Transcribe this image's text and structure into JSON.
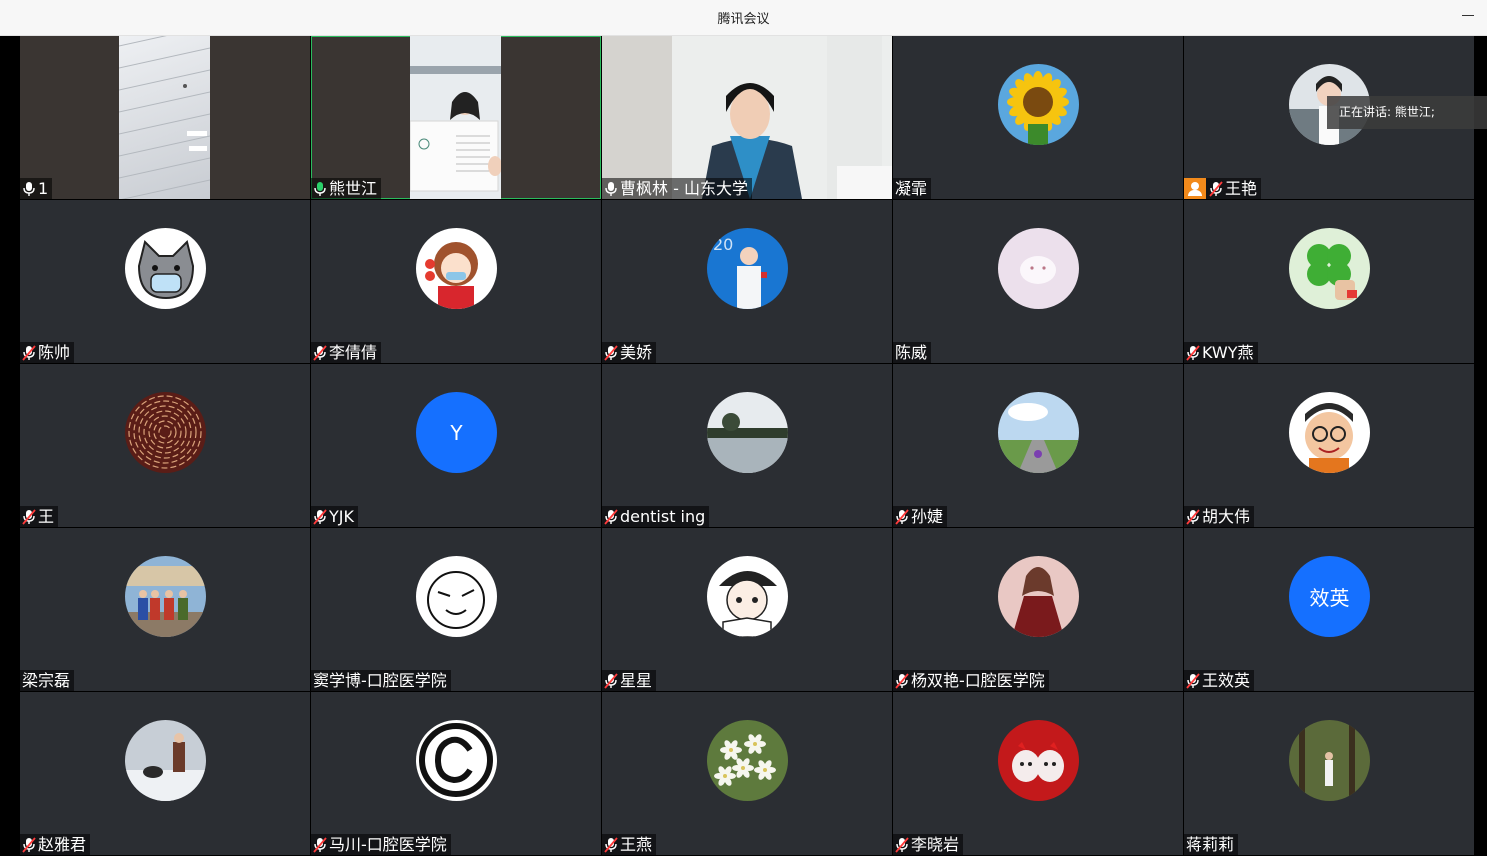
{
  "window": {
    "title": "腾讯会议"
  },
  "speaking_banner": "正在讲话: 熊世江;",
  "participants": [
    {
      "name": "1",
      "mic": "on",
      "kind": "video-ceiling"
    },
    {
      "name": "熊世江",
      "mic": "on-green",
      "kind": "video-cert",
      "active": true
    },
    {
      "name": "曹枫林 - 山东大学",
      "mic": "on",
      "kind": "video-person"
    },
    {
      "name": "凝霏",
      "mic": "none",
      "kind": "avatar",
      "avatar": "sunflower"
    },
    {
      "name": "王艳",
      "mic": "muted",
      "kind": "avatar",
      "avatar": "woman-photo",
      "host": true
    },
    {
      "name": "陈帅",
      "mic": "muted",
      "kind": "avatar",
      "avatar": "cat-mask"
    },
    {
      "name": "李倩倩",
      "mic": "muted",
      "kind": "avatar",
      "avatar": "cartoon-girl"
    },
    {
      "name": "美娇",
      "mic": "muted",
      "kind": "avatar",
      "avatar": "child-astronaut"
    },
    {
      "name": "陈威",
      "mic": "none",
      "kind": "avatar",
      "avatar": "white-cat"
    },
    {
      "name": "KWY燕",
      "mic": "muted",
      "kind": "avatar",
      "avatar": "clover"
    },
    {
      "name": "王",
      "mic": "muted",
      "kind": "avatar",
      "avatar": "maze-pattern"
    },
    {
      "name": "YJK",
      "mic": "muted",
      "kind": "avatar",
      "avatar": "letter",
      "letter": "Y"
    },
    {
      "name": "dentist ing",
      "mic": "muted",
      "kind": "avatar",
      "avatar": "lake"
    },
    {
      "name": "孙婕",
      "mic": "muted",
      "kind": "avatar",
      "avatar": "road-sky"
    },
    {
      "name": "胡大伟",
      "mic": "muted",
      "kind": "avatar",
      "avatar": "cartoon-man"
    },
    {
      "name": "梁宗磊",
      "mic": "none",
      "kind": "avatar",
      "avatar": "group-photo"
    },
    {
      "name": "窦学博-口腔医学院",
      "mic": "none",
      "kind": "avatar",
      "avatar": "doodle-face"
    },
    {
      "name": "星星",
      "mic": "muted",
      "kind": "avatar",
      "avatar": "anime-girl"
    },
    {
      "name": "杨双艳-口腔医学院",
      "mic": "muted",
      "kind": "avatar",
      "avatar": "doll"
    },
    {
      "name": "王效英",
      "mic": "muted",
      "kind": "avatar",
      "avatar": "letter",
      "letter": "效英"
    },
    {
      "name": "赵雅君",
      "mic": "muted",
      "kind": "avatar",
      "avatar": "snow-dog"
    },
    {
      "name": "马川-口腔医学院",
      "mic": "muted",
      "kind": "avatar",
      "avatar": "copyright"
    },
    {
      "name": "王燕",
      "mic": "muted",
      "kind": "avatar",
      "avatar": "lilies"
    },
    {
      "name": "李晓岩",
      "mic": "muted",
      "kind": "avatar",
      "avatar": "red-eggs"
    },
    {
      "name": "蒋莉莉",
      "mic": "none",
      "kind": "avatar",
      "avatar": "forest-girl"
    }
  ]
}
